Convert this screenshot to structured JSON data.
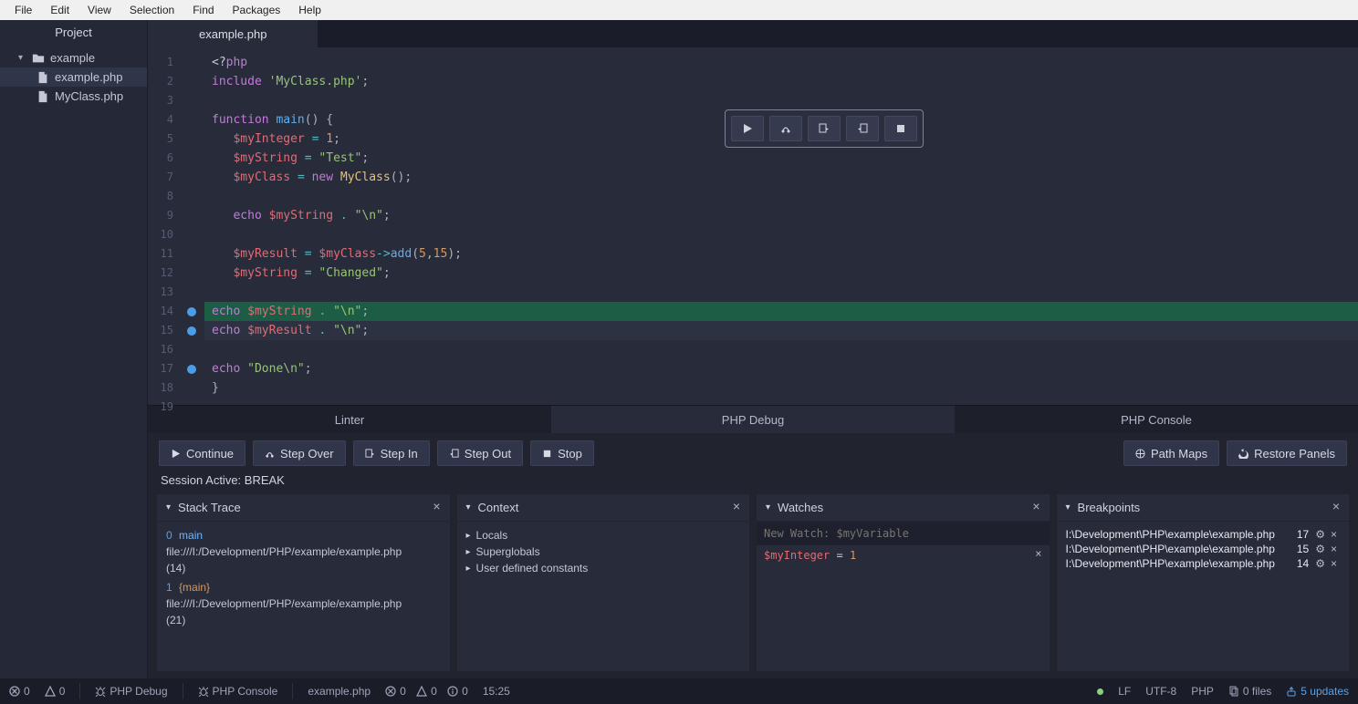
{
  "menubar": [
    "File",
    "Edit",
    "View",
    "Selection",
    "Find",
    "Packages",
    "Help"
  ],
  "sidebar": {
    "title": "Project",
    "root": {
      "label": "example",
      "expanded": true
    },
    "files": [
      {
        "label": "example.php",
        "selected": true
      },
      {
        "label": "MyClass.php",
        "selected": false
      }
    ]
  },
  "editor": {
    "tab": "example.php",
    "breakpoints": [
      14,
      15,
      17
    ],
    "highlight_line": 14,
    "cursor_line": 15,
    "line_count": 19
  },
  "debug_float": [
    "play",
    "step-over",
    "step-in",
    "step-out",
    "stop"
  ],
  "bottom_tabs": {
    "items": [
      "Linter",
      "PHP Debug",
      "PHP Console"
    ],
    "active": 1
  },
  "debug_buttons": {
    "continue": "Continue",
    "step_over": "Step Over",
    "step_in": "Step In",
    "step_out": "Step Out",
    "stop": "Stop",
    "path_maps": "Path Maps",
    "restore": "Restore Panels"
  },
  "session_status": "Session Active: BREAK",
  "panels": {
    "stack": {
      "title": "Stack Trace",
      "frames": [
        {
          "idx": "0",
          "fn": "main",
          "path": "file:///I:/Development/PHP/example/example.php",
          "line": "(14)"
        },
        {
          "idx": "1",
          "fn": "{main}",
          "path": "file:///I:/Development/PHP/example/example.php",
          "line": "(21)"
        }
      ]
    },
    "context": {
      "title": "Context",
      "groups": [
        "Locals",
        "Superglobals",
        "User defined constants"
      ]
    },
    "watches": {
      "title": "Watches",
      "placeholder": "New Watch: $myVariable",
      "entries": [
        {
          "var": "$myInteger",
          "val": "1"
        }
      ]
    },
    "breakpoints": {
      "title": "Breakpoints",
      "items": [
        {
          "path": "I:\\Development\\PHP\\example\\example.php",
          "line": "17"
        },
        {
          "path": "I:\\Development\\PHP\\example\\example.php",
          "line": "15"
        },
        {
          "path": "I:\\Development\\PHP\\example\\example.php",
          "line": "14"
        }
      ]
    }
  },
  "statusbar": {
    "err": "0",
    "warn": "0",
    "php_debug": "PHP Debug",
    "php_console": "PHP Console",
    "file": "example.php",
    "diag_err": "0",
    "diag_warn": "0",
    "diag_info": "0",
    "cursor": "15:25",
    "eol": "LF",
    "encoding": "UTF-8",
    "lang": "PHP",
    "files": "0 files",
    "updates": "5 updates"
  }
}
